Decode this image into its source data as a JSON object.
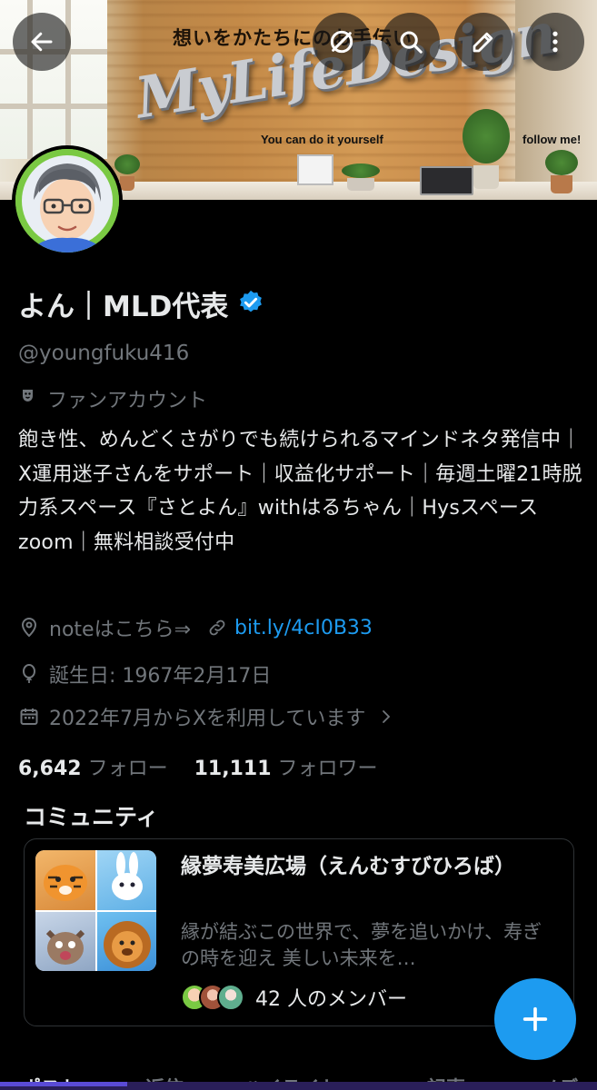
{
  "banner": {
    "tagline": "想いをかたちにのお手伝い",
    "logo": "MyLifeDesign",
    "subtitle": "You can do it yourself",
    "follow": "follow me!"
  },
  "nav": {
    "back_icon": "arrow-left-icon",
    "mute_icon": "no-notification-icon",
    "search_icon": "search-icon",
    "edit_icon": "pencil-icon",
    "more_icon": "more-vertical-icon"
  },
  "profile": {
    "display_name": "よん｜MLD代表",
    "handle": "@youngfuku416",
    "category": "ファンアカウント",
    "bio": "飽き性、めんどくさがりでも続けられるマインドネタ発信中｜X運用迷子さんをサポート｜収益化サポート｜毎週土曜21時脱力系スペース『さとよん』withはるちゃん｜Hysスペース zoom｜無料相談受付中",
    "location": "noteはこちら⇒",
    "link": "bit.ly/4cI0B33",
    "birthday": "誕生日: 1967年2月17日",
    "joined": "2022年7月からXを利用しています",
    "following_count": "6,642",
    "following_label": "フォロー",
    "followers_count": "11,111",
    "followers_label": "フォロワー"
  },
  "community": {
    "section_title": "コミュニティ",
    "name": "縁夢寿美広場（えんむすびひろば）",
    "description": "縁が結ぶこの世界で、夢を追いかけ、寿ぎの時を迎え 美しい未来を…",
    "members": "42 人のメンバー"
  },
  "tabs": [
    "ポスト",
    "返信",
    "ハイライト",
    "記事",
    "メディア"
  ],
  "colors": {
    "accent": "#1d9bf0",
    "background": "#000000",
    "text": "#e7e9ea",
    "muted": "#71767b"
  }
}
